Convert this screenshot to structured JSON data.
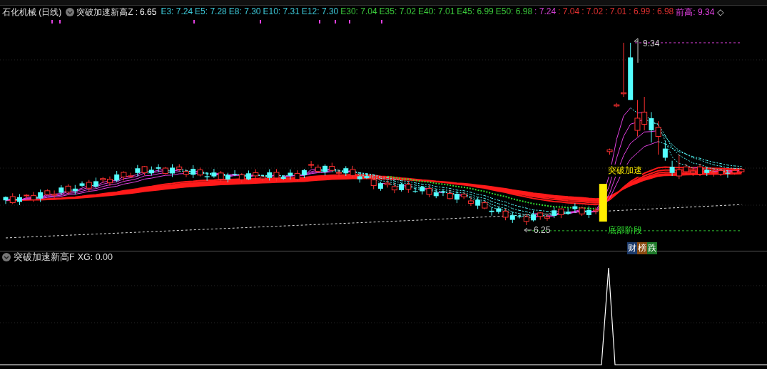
{
  "header": {
    "stock_title": "石化机械 (日线)",
    "indicator": {
      "name": "突破加速新高Z",
      "separator": ":",
      "value": "6.65"
    },
    "legend": [
      {
        "label": "E3:",
        "value": "7.24",
        "color": "#3cc8d8"
      },
      {
        "label": "E5:",
        "value": "7.28",
        "color": "#3cc8d8"
      },
      {
        "label": "E8:",
        "value": "7.30",
        "color": "#3cc8d8"
      },
      {
        "label": "E10:",
        "value": "7.31",
        "color": "#3cc8d8"
      },
      {
        "label": "E12:",
        "value": "7.30",
        "color": "#3cc8d8"
      },
      {
        "label": "E30:",
        "value": "7.04",
        "color": "#3ac83a"
      },
      {
        "label": "E35:",
        "value": "7.02",
        "color": "#3ac83a"
      },
      {
        "label": "E40:",
        "value": "7.01",
        "color": "#3ac83a"
      },
      {
        "label": "E45:",
        "value": "6.99",
        "color": "#3ac83a"
      },
      {
        "label": "E50:",
        "value": "6.98",
        "color": "#3ac83a"
      },
      {
        "label": ":",
        "value": "7.24",
        "color": "#d040d0"
      },
      {
        "label": ":",
        "value": "7.04",
        "color": "#e03030"
      },
      {
        "label": ":",
        "value": "7.02",
        "color": "#e03030"
      },
      {
        "label": ":",
        "value": "7.01",
        "color": "#e03030"
      },
      {
        "label": ":",
        "value": "6.99",
        "color": "#e03030"
      },
      {
        "label": ":",
        "value": "6.98",
        "color": "#e03030"
      },
      {
        "label": "前高:",
        "value": "9.34",
        "color": "#e040e0"
      }
    ],
    "end_mark": "◇"
  },
  "main_chart": {
    "high_label": "9.34",
    "low_label": "6.25",
    "signal_label": "突破加速",
    "stage_label": "底部阶段",
    "badges": [
      {
        "text": "财",
        "color": "#1c3a6a"
      },
      {
        "text": "榜",
        "color": "#8a4a10"
      },
      {
        "text": "跌",
        "color": "#1f7a2a"
      }
    ]
  },
  "sub_chart": {
    "indicator_name": "突破加速新高F",
    "reading": "XG: 0.00"
  }
}
